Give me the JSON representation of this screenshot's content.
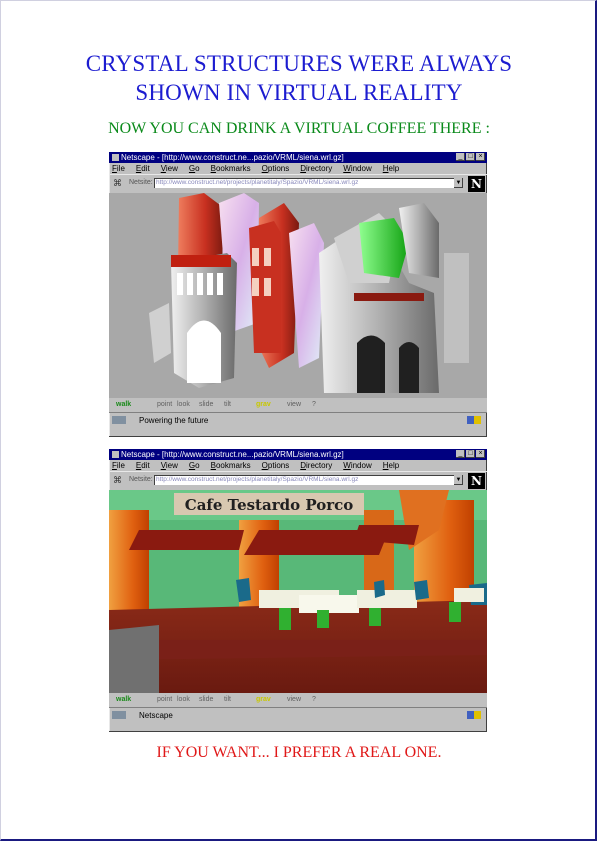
{
  "heading": {
    "line1": "CRYSTAL STRUCTURES WERE ALWAYS",
    "line2": "SHOWN IN VIRTUAL REALITY"
  },
  "subheading": "NOW YOU CAN DRINK A VIRTUAL COFFEE THERE :",
  "footer": "IF YOU WANT... I PREFER A REAL ONE.",
  "window1": {
    "title": "Netscape - [http://www.construct.ne...pazio/VRML/siena.wrl.gz]",
    "menu": [
      "File",
      "Edit",
      "View",
      "Go",
      "Bookmarks",
      "Options",
      "Directory",
      "Window",
      "Help"
    ],
    "location_label": "Netsite:",
    "location_value": "http://www.construct.net/projects/planetitaly/Spazio/VRML/siena.wrl.gz",
    "status_text": "Powering the future",
    "nav": {
      "walk": "walk",
      "point": "point",
      "look": "look",
      "slide": "slide",
      "tilt": "tilt",
      "gravity": "grav",
      "view": "view",
      "help": "?"
    }
  },
  "window2": {
    "title": "Netscape - [http://www.construct.ne...pazio/VRML/siena.wrl.gz]",
    "menu": [
      "File",
      "Edit",
      "View",
      "Go",
      "Bookmarks",
      "Options",
      "Directory",
      "Window",
      "Help"
    ],
    "location_label": "Netsite:",
    "location_value": "http://www.construct.net/projects/planetitaly/Spazio/VRML/siena.wrl.gz",
    "status_text": "Netscape",
    "sign_text": "Cafe Testardo Porco",
    "nav": {
      "walk": "walk",
      "point": "point",
      "look": "look",
      "slide": "slide",
      "tilt": "tilt",
      "gravity": "grav",
      "view": "view",
      "help": "?"
    }
  },
  "colors": {
    "heading": "#1c1cd0",
    "subheading": "#0a8a1a",
    "footer": "#e01818",
    "titlebar": "#000080",
    "window_chrome": "#c0c0c0"
  },
  "icons": {
    "browser": "netscape-n-logo",
    "window_buttons": [
      "minimize-icon",
      "maximize-icon",
      "close-icon"
    ]
  }
}
